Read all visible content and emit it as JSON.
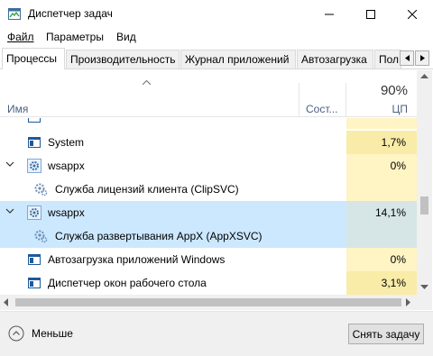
{
  "window": {
    "title": "Диспетчер задач"
  },
  "menu": {
    "file": "Файл",
    "params": "Параметры",
    "view": "Вид"
  },
  "tabs": [
    {
      "label": "Процессы",
      "active": true
    },
    {
      "label": "Производительность",
      "active": false
    },
    {
      "label": "Журнал приложений",
      "active": false
    },
    {
      "label": "Автозагрузка",
      "active": false
    },
    {
      "label": "Пол",
      "active": false
    }
  ],
  "header": {
    "name": "Имя",
    "status": "Сост...",
    "cpu_total": "90%",
    "cpu": "ЦП"
  },
  "rows": [
    {
      "label": "",
      "cpu": "",
      "kind": "app",
      "indent": 0
    },
    {
      "label": "System",
      "cpu": "1,7%",
      "kind": "window",
      "indent": 0
    },
    {
      "label": "wsappx",
      "cpu": "0%",
      "kind": "gear",
      "indent": 0,
      "expanded": true
    },
    {
      "label": "Служба лицензий клиента (ClipSVC)",
      "cpu": "",
      "kind": "service",
      "indent": 1
    },
    {
      "label": "wsappx",
      "cpu": "14,1%",
      "kind": "gear",
      "indent": 0,
      "expanded": true,
      "selected": true
    },
    {
      "label": "Служба развертывания AppX (AppXSVC)",
      "cpu": "",
      "kind": "service",
      "indent": 1,
      "selected": true
    },
    {
      "label": "Автозагрузка приложений Windows",
      "cpu": "0%",
      "kind": "window",
      "indent": 0
    },
    {
      "label": "Диспетчер окон рабочего стола",
      "cpu": "3,1%",
      "kind": "window",
      "indent": 0
    }
  ],
  "footer": {
    "less": "Меньше",
    "end_task": "Снять задачу"
  },
  "colors": {
    "cpu_light": "#fff4c4",
    "cpu_medium": "#f9eca8",
    "selected": "#cce8ff",
    "header_text": "#4d6082"
  }
}
